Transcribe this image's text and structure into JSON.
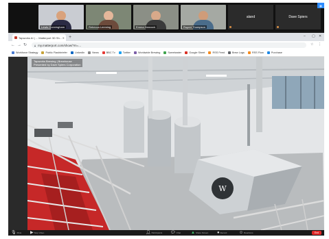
{
  "participants": [
    {
      "name": "Lewis Cunningham",
      "skin": "#d9a27c",
      "shirt": "#2b2b44",
      "bg": "#c9ccd2"
    },
    {
      "name": "Rebecca Leeming",
      "skin": "#e4b79a",
      "shirt": "#6d4b3c",
      "bg": "#7d8775"
    },
    {
      "name": "Emma Hancock",
      "skin": "#d8a98a",
      "shirt": "#3a3a3a",
      "bg": "#8b8f86"
    },
    {
      "name": "Rupert Thompson",
      "skin": "#cf9c79",
      "shirt": "#4a6c8a",
      "bg": "#a5a9a3"
    }
  ],
  "name_tiles": [
    {
      "label": "aland"
    },
    {
      "label": "Dave Spiers"
    }
  ],
  "browser": {
    "tab_title": "Tapworks AI | ... Matterport 3D Sh...",
    "url": "my.matterport.com/show/?m=...",
    "bookmarks": [
      {
        "label": "Workforce Strategy",
        "color": "#4a7bd1"
      },
      {
        "label": "Public Flashbriefer",
        "color": "#c7a338"
      },
      {
        "label": "LinkedIn",
        "color": "#0a66c2"
      },
      {
        "label": "News",
        "color": "#888888"
      },
      {
        "label": "BBC Tv",
        "color": "#e53935"
      },
      {
        "label": "Twitter",
        "color": "#1da1f2"
      },
      {
        "label": "Worldwide Brewing",
        "color": "#7b5ea7"
      },
      {
        "label": "Sweetwater",
        "color": "#3fa34d"
      },
      {
        "label": "Google Sheet",
        "color": "#d93025"
      },
      {
        "label": "RSS Feed",
        "color": "#f48b1f"
      },
      {
        "label": "Brew Logs",
        "color": "#5f6368"
      },
      {
        "label": "RSS Flow",
        "color": "#f48b1f"
      },
      {
        "label": "Purchase",
        "color": "#1e88e5"
      }
    ]
  },
  "tour": {
    "overlay_line1": "Tapworks Brewing | Brewhouse",
    "overlay_line2": "Presented by Dave Spiers Corporation"
  },
  "toolbar": {
    "mute": "Mute",
    "video": "Stop Video",
    "participants": "Participants",
    "chat": "Chat",
    "share": "Share Screen",
    "record": "Record",
    "reactions": "Reactions",
    "end": "End"
  },
  "colors": {
    "accent": "#2d8cff",
    "end_red": "#e02828",
    "floor_red": "#c62828"
  }
}
